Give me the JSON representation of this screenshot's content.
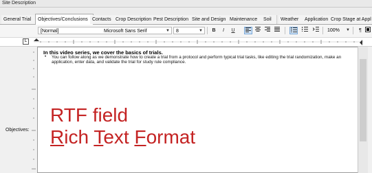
{
  "window": {
    "title": "Site Description"
  },
  "tabs": [
    {
      "label": "General Trial",
      "active": false
    },
    {
      "label": "Objectives/Conclusions",
      "active": true
    },
    {
      "label": "Contacts",
      "active": false
    },
    {
      "label": "Crop Description",
      "active": false
    },
    {
      "label": "Pest Description",
      "active": false
    },
    {
      "label": "Site and Design",
      "active": false
    },
    {
      "label": "Maintenance",
      "active": false
    },
    {
      "label": "Soil",
      "active": false
    },
    {
      "label": "Weather",
      "active": false
    },
    {
      "label": "Application",
      "active": false
    },
    {
      "label": "Crop Stage at Appl",
      "active": false
    }
  ],
  "toolbar": {
    "style_value": "[Normal]",
    "font_value": "Microsoft Sans Serif",
    "size_value": "8",
    "bold": "B",
    "italic": "I",
    "underline": "U",
    "zoom_value": "100%",
    "pilcrow": "¶"
  },
  "ruler": {
    "box_label": "L"
  },
  "editor": {
    "heading": "In this video series, we cover the basics of trials.",
    "bullet": "•",
    "body": "You can follow along as we demonstrate how to create a trial from a protocol and perform typical trial tasks, like editing the trial randomization, make an application, enter data, and validate the trial for study rule compliance."
  },
  "field_label": "Objectives:",
  "overlay": {
    "line1": "RTF field",
    "line2_r": "R",
    "line2_rest1": "ich ",
    "line2_t": "T",
    "line2_rest2": "ext ",
    "line2_f": "F",
    "line2_rest3": "ormat"
  },
  "colors": {
    "accent": "#c42323",
    "pressed": "#cfe3f7"
  }
}
